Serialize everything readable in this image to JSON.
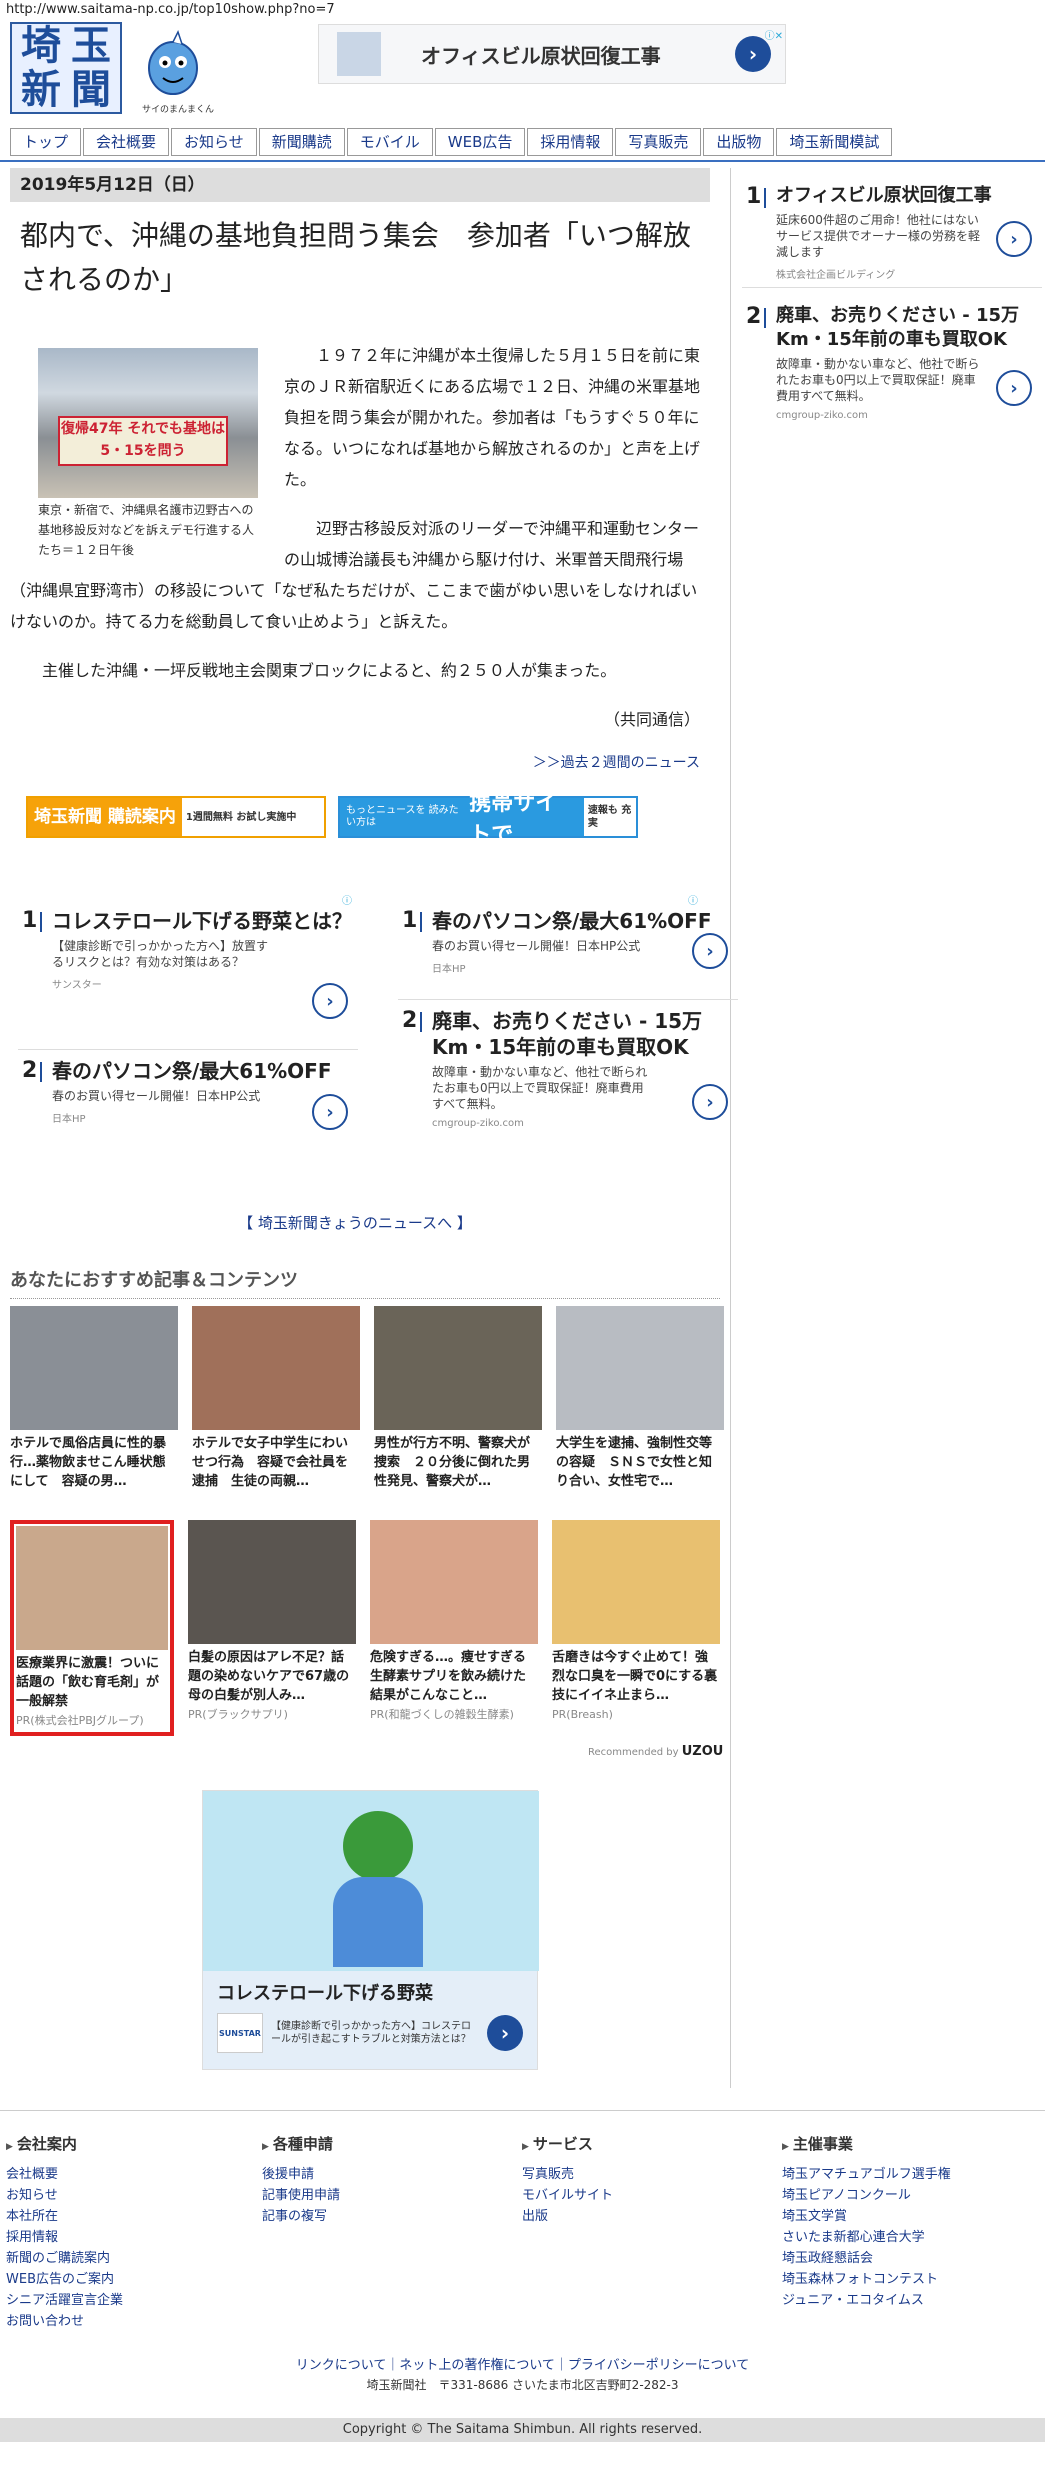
{
  "url": "http://www.saitama-np.co.jp/top10show.php?no=7",
  "header": {
    "logo_chars": [
      "埼",
      "玉",
      "新",
      "聞"
    ],
    "mascot_caption": "サイのまんまくん",
    "top_ad": {
      "title": "オフィスビル原状回復工事",
      "arrow": "›"
    }
  },
  "nav": [
    "トップ",
    "会社概要",
    "お知らせ",
    "新聞購読",
    "モバイル",
    "WEB広告",
    "採用情報",
    "写真販売",
    "出版物",
    "埼玉新聞模試"
  ],
  "article": {
    "date": "2019年5月12日（日）",
    "headline": "都内で、沖縄の基地負担問う集会　参加者「いつ解放されるのか」",
    "photo_banner": "復帰47年 それでも基地は5・15を問う",
    "photo_caption": "東京・新宿で、沖縄県名護市辺野古への基地移設反対などを訴えデモ行進する人たち＝１２日午後",
    "paragraphs": [
      "１９７２年に沖縄が本土復帰した５月１５日を前に東京のＪＲ新宿駅近くにある広場で１２日、沖縄の米軍基地負担を問う集会が開かれた。参加者は「もうすぐ５０年になる。いつになれば基地から解放されるのか」と声を上げた。",
      "辺野古移設反対派のリーダーで沖縄平和運動センターの山城博治議長も沖縄から駆け付け、米軍普天間飛行場（沖縄県宜野湾市）の移設について「なぜ私たちだけが、ここまで歯がゆい思いをしなければいけないのか。持てる力を総動員して食い止めよう」と訴えた。",
      "主催した沖縄・一坪反戦地主会関東ブロックによると、約２５０人が集まった。"
    ],
    "credit": "（共同通信）",
    "past_link": "＞＞過去２週間のニュース"
  },
  "banners": {
    "subscribe": {
      "brand": "埼玉新聞 購読案内",
      "note": "1週間無料 お試し実施中"
    },
    "mobile": {
      "pre": "もっとニュースを 読みたい方は",
      "main": "携帯サイトで",
      "note": "速報も 充実"
    }
  },
  "mid_ads_left": [
    {
      "num": "1",
      "title": "コレステロール下げる野菜とは？",
      "desc": "【健康診断で引っかかった方へ】放置するリスクとは？有効な対策はある？",
      "src": "サンスター"
    },
    {
      "num": "2",
      "title": "春のパソコン祭/最大61%OFF",
      "desc": "春のお買い得セール開催！日本HP公式",
      "src": "日本HP"
    }
  ],
  "mid_ads_right": [
    {
      "num": "1",
      "title": "春のパソコン祭/最大61%OFF",
      "desc": "春のお買い得セール開催！日本HP公式",
      "src": "日本HP"
    },
    {
      "num": "2",
      "title": "廃車、お売りください - 15万Km・15年前の車も買取OK",
      "desc": "故障車・動かない車など、他社で断られたお車も0円以上で買取保証！廃車費用すべて無料。",
      "src": "cmgroup-ziko.com"
    }
  ],
  "today_link": "【 埼玉新聞きょうのニュースへ 】",
  "recommend": {
    "heading": "あなたにおすすめ記事＆コンテンツ",
    "row1": [
      {
        "text": "ホテルで風俗店員に性的暴行…薬物飲ませこん睡状態にして　容疑の男…",
        "color": "#8a8f96"
      },
      {
        "text": "ホテルで女子中学生にわいせつ行為　容疑で会社員を逮捕　生徒の両親…",
        "color": "#a0705a"
      },
      {
        "text": "男性が行方不明、警察犬が捜索　２０分後に倒れた男性発見、警察犬が…",
        "color": "#6a6458"
      },
      {
        "text": "大学生を逮捕、強制性交等の容疑　ＳＮＳで女性と知り合い、女性宅で…",
        "color": "#b8bcc2"
      }
    ],
    "row2": [
      {
        "text": "医療業界に激震！ついに話題の「飲む育毛剤」が一般解禁",
        "pr": "PR(株式会社PBJグループ)",
        "color": "#c9a88c"
      },
      {
        "text": "白髪の原因はアレ不足？話題の染めないケアで67歳の母の白髪が別人み…",
        "pr": "PR(ブラックサプリ)",
        "color": "#5a5550"
      },
      {
        "text": "危険すぎる…。痩せすぎる生酵素サプリを飲み続けた結果がこんなこと…",
        "pr": "PR(和龍づくしの雑穀生酵素)",
        "color": "#d9a48a"
      },
      {
        "text": "舌磨きは今すぐ止めて！強烈な口臭を一瞬で0にする裏技にイイネ止まら…",
        "pr": "PR(Breash)",
        "color": "#e8c070"
      }
    ],
    "recommended_by": "Recommended by",
    "brand": "UZOU"
  },
  "bottom_ad": {
    "title": "コレステロール下げる野菜",
    "logo": "SUNSTAR",
    "desc": "【健康診断で引っかかった方へ】コレステロールが引き起こすトラブルと対策方法とは？"
  },
  "sidebar_ads": [
    {
      "num": "1",
      "title": "オフィスビル原状回復工事",
      "desc": "延床600件超のご用命！他社にはないサービス提供でオーナー様の労務を軽減します",
      "src": "株式会社企画ビルディング"
    },
    {
      "num": "2",
      "title": "廃車、お売りください - 15万Km・15年前の車も買取OK",
      "desc": "故障車・動かない車など、他社で断られたお車も0円以上で買取保証！廃車費用すべて無料。",
      "src": "cmgroup-ziko.com"
    }
  ],
  "footer": {
    "cols": [
      {
        "heading": "会社案内",
        "links": [
          "会社概要",
          "お知らせ",
          "本社所在",
          "採用情報",
          "新聞のご購読案内",
          "WEB広告のご案内",
          "シニア活躍宣言企業",
          "お問い合わせ"
        ]
      },
      {
        "heading": "各種申請",
        "links": [
          "後援申請",
          "記事使用申請",
          "記事の複写"
        ]
      },
      {
        "heading": "サービス",
        "links": [
          "写真販売",
          "モバイルサイト",
          "出版"
        ]
      },
      {
        "heading": "主催事業",
        "links": [
          "埼玉アマチュアゴルフ選手権",
          "埼玉ピアノコンクール",
          "埼玉文学賞",
          "さいたま新都心連合大学",
          "埼玉政経懇話会",
          "埼玉森林フォトコンテスト",
          "ジュニア・エコタイムス"
        ]
      }
    ],
    "links_line": "リンクについて｜ネット上の著作権について｜プライバシーポリシーについて",
    "address": "埼玉新聞社　〒331-8686 さいたま市北区吉野町2-282-3",
    "copyright": "Copyright © The Saitama Shimbun. All rights reserved."
  }
}
